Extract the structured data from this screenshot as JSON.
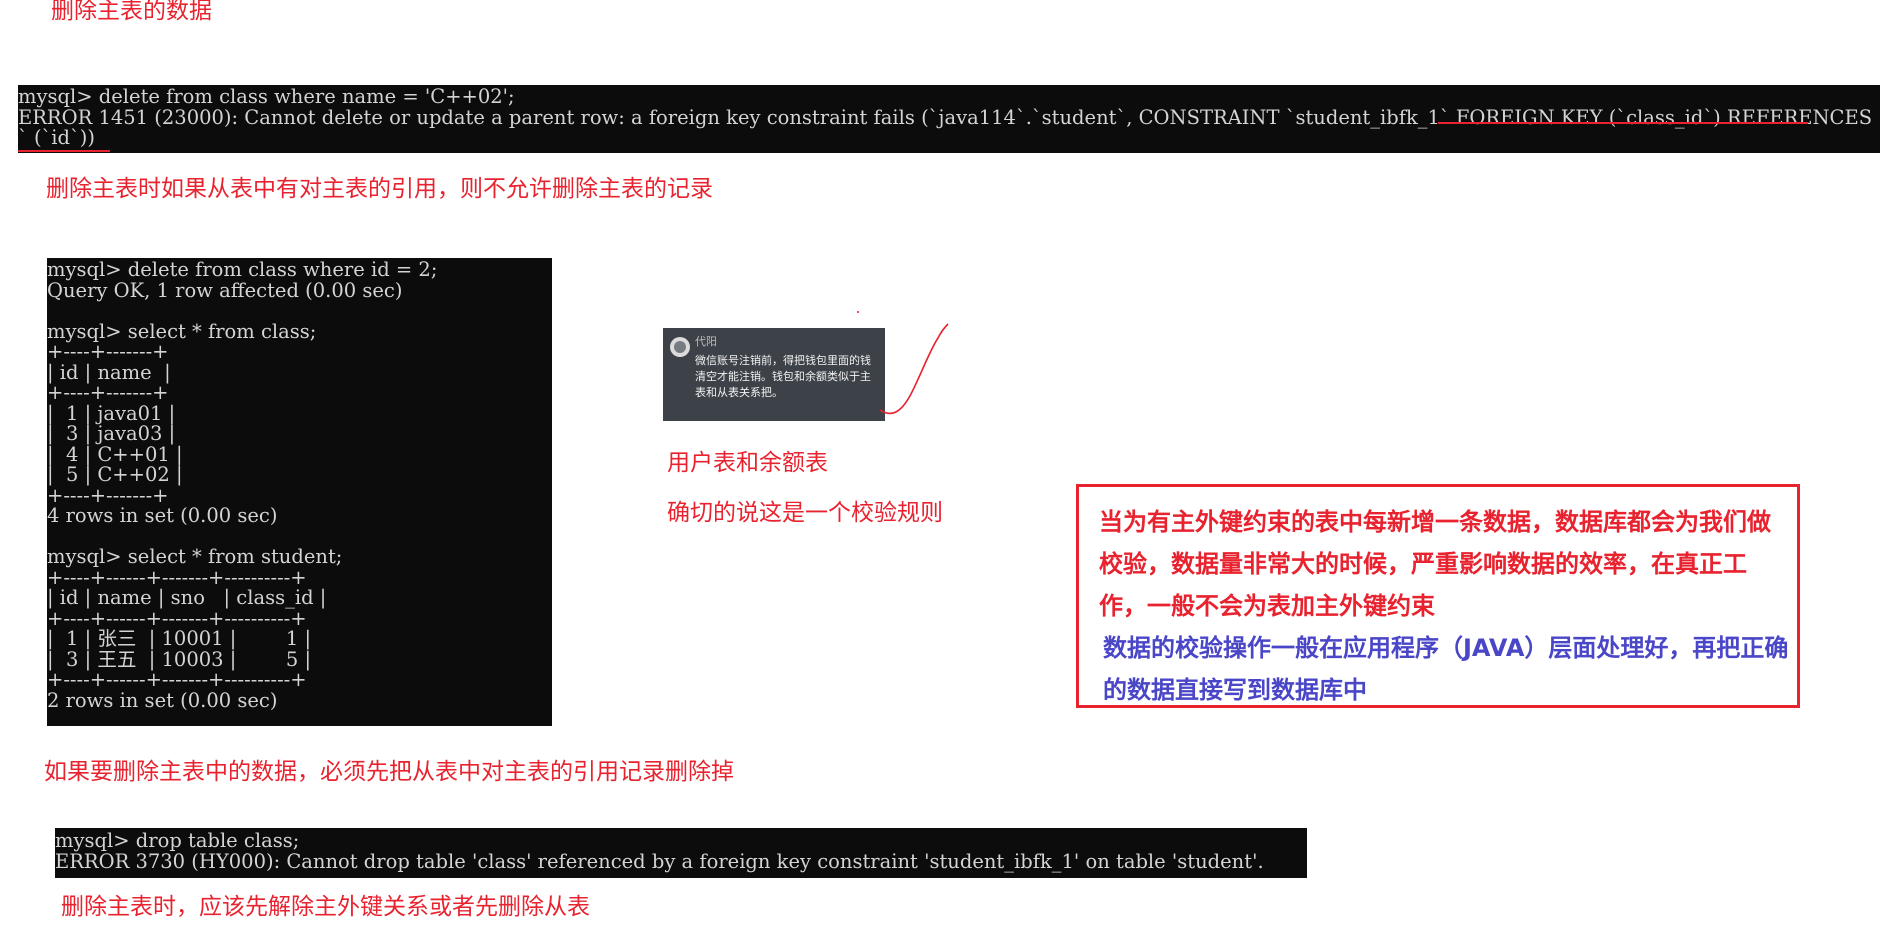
{
  "notes": {
    "title": "删除主表的数据",
    "note1": "删除主表时如果从表中有对主表的引用，则不允许删除主表的记录",
    "note2": "用户表和余额表",
    "note3": "确切的说这是一个校验规则",
    "note4": "如果要删除主表中的数据，必须先把从表中对主表的引用记录删除掉",
    "note5": "删除主表时，应该先解除主外键关系或者先删除从表"
  },
  "terminal1": {
    "lines": [
      "mysql> delete from class where name = 'C++02';",
      "ERROR 1451 (23000): Cannot delete or update a parent row: a foreign key constraint fails (`java114`.`student`, CONSTRAINT `student_ibfk_1` FOREIGN KEY (`class_id`) REFERENCES `class",
      "` (`id`))"
    ]
  },
  "terminal2": {
    "lines": [
      "mysql> delete from class where id = 2;",
      "Query OK, 1 row affected (0.00 sec)",
      "",
      "mysql> select * from class;",
      "+----+-------+",
      "| id | name  |",
      "+----+-------+",
      "|  1 | java01 |",
      "|  3 | java03 |",
      "|  4 | C++01 |",
      "|  5 | C++02 |",
      "+----+-------+",
      "4 rows in set (0.00 sec)",
      "",
      "mysql> select * from student;",
      "+----+------+-------+----------+",
      "| id | name | sno   | class_id |",
      "+----+------+-------+----------+",
      "|  1 | 张三  | 10001 |        1 |",
      "|  3 | 王五  | 10003 |        5 |",
      "+----+------+-------+----------+",
      "2 rows in set (0.00 sec)"
    ]
  },
  "terminal3": {
    "lines": [
      "mysql> drop table class;",
      "ERROR 3730 (HY000): Cannot drop table 'class' referenced by a foreign key constraint 'student_ibfk_1' on table 'student'."
    ]
  },
  "chat": {
    "name": "代阳",
    "message": "微信账号注销前，得把钱包里面的钱清空才能注销。钱包和余额类似于主表和从表关系把。"
  },
  "callout": {
    "red_text": "当为有主外键约束的表中每新增一条数据，数据库都会为我们做校验，数据量非常大的时候，严重影响数据的效率，在真正工作，一般不会为表加主外键约束",
    "blue_text": "数据的校验操作一般在应用程序（JAVA）层面处理好，再把正确的数据直接写到数据库中"
  },
  "colors": {
    "annotation_red": "#e8232f",
    "callout_blue": "#4a46c8",
    "terminal_bg": "#0c0c0c",
    "terminal_text": "#d4d4d4"
  }
}
